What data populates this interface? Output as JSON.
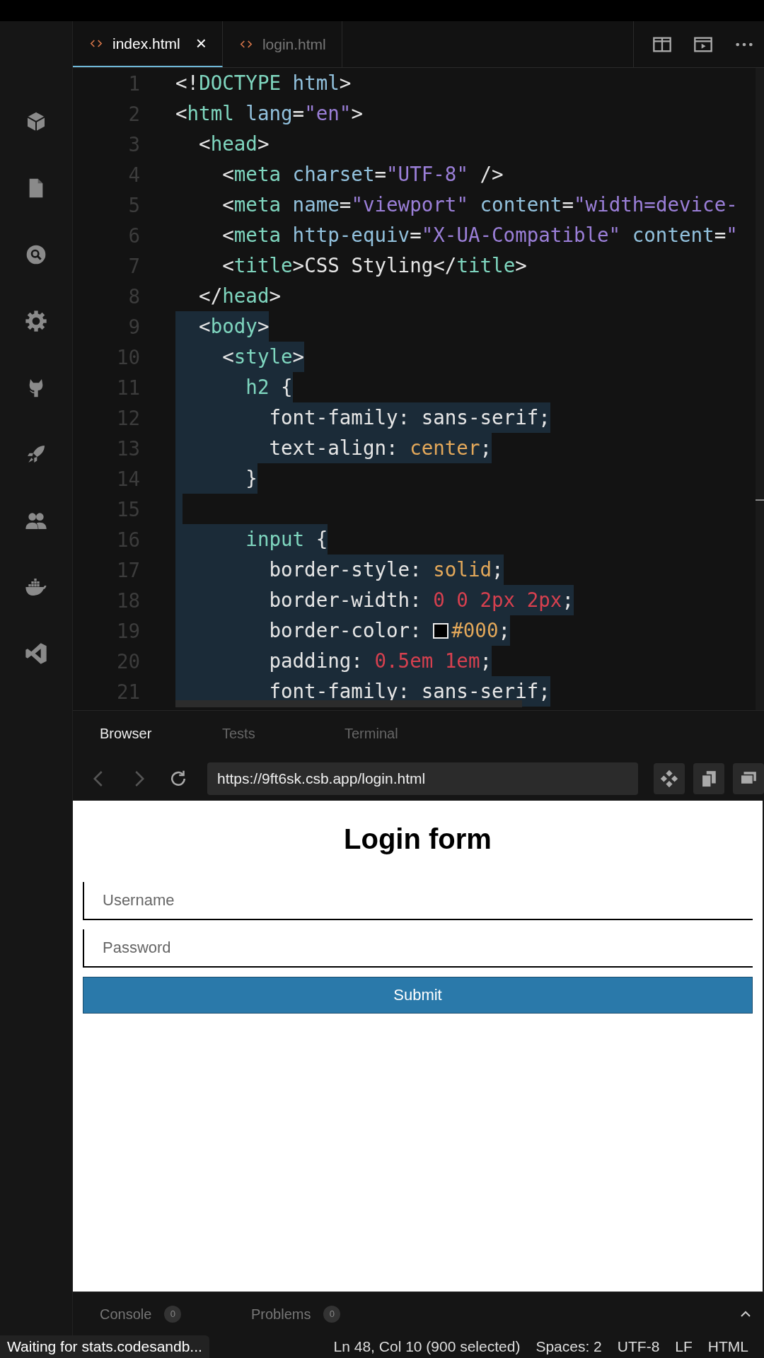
{
  "editor_tabs": [
    {
      "label": "index.html",
      "selected": true,
      "close": "×"
    },
    {
      "label": "login.html",
      "selected": false
    }
  ],
  "code_lines": [
    {
      "number": "1",
      "selected": false,
      "tokens": [
        {
          "text": "<!",
          "kind": "punct"
        },
        {
          "text": "DOCTYPE",
          "kind": "tag"
        },
        {
          "text": " html",
          "kind": "attr"
        },
        {
          "text": ">",
          "kind": "punct"
        }
      ]
    },
    {
      "number": "2",
      "selected": false,
      "tokens": [
        {
          "text": "<",
          "kind": "punct"
        },
        {
          "text": "html",
          "kind": "tag"
        },
        {
          "text": " lang",
          "kind": "attr"
        },
        {
          "text": "=",
          "kind": "punct"
        },
        {
          "text": "\"en\"",
          "kind": "string"
        },
        {
          "text": ">",
          "kind": "punct"
        }
      ]
    },
    {
      "number": "3",
      "selected": false,
      "tokens": [
        {
          "text": "  <",
          "kind": "punct"
        },
        {
          "text": "head",
          "kind": "tag"
        },
        {
          "text": ">",
          "kind": "punct"
        }
      ]
    },
    {
      "number": "4",
      "selected": false,
      "tokens": [
        {
          "text": "    <",
          "kind": "punct"
        },
        {
          "text": "meta",
          "kind": "tag"
        },
        {
          "text": " charset",
          "kind": "attr"
        },
        {
          "text": "=",
          "kind": "punct"
        },
        {
          "text": "\"UTF-8\"",
          "kind": "string"
        },
        {
          "text": " />",
          "kind": "punct"
        }
      ]
    },
    {
      "number": "5",
      "selected": false,
      "tokens": [
        {
          "text": "    <",
          "kind": "punct"
        },
        {
          "text": "meta",
          "kind": "tag"
        },
        {
          "text": " name",
          "kind": "attr"
        },
        {
          "text": "=",
          "kind": "punct"
        },
        {
          "text": "\"viewport\"",
          "kind": "string"
        },
        {
          "text": " content",
          "kind": "attr"
        },
        {
          "text": "=",
          "kind": "punct"
        },
        {
          "text": "\"width=device-",
          "kind": "string"
        }
      ]
    },
    {
      "number": "6",
      "selected": false,
      "tokens": [
        {
          "text": "    <",
          "kind": "punct"
        },
        {
          "text": "meta",
          "kind": "tag"
        },
        {
          "text": " http-equiv",
          "kind": "attr"
        },
        {
          "text": "=",
          "kind": "punct"
        },
        {
          "text": "\"X-UA-Compatible\"",
          "kind": "string"
        },
        {
          "text": " content",
          "kind": "attr"
        },
        {
          "text": "=",
          "kind": "punct"
        },
        {
          "text": "\"",
          "kind": "string"
        }
      ]
    },
    {
      "number": "7",
      "selected": false,
      "tokens": [
        {
          "text": "    <",
          "kind": "punct"
        },
        {
          "text": "title",
          "kind": "tag"
        },
        {
          "text": ">",
          "kind": "punct"
        },
        {
          "text": "CSS Styling",
          "kind": "text"
        },
        {
          "text": "</",
          "kind": "punct"
        },
        {
          "text": "title",
          "kind": "tag"
        },
        {
          "text": ">",
          "kind": "punct"
        }
      ]
    },
    {
      "number": "8",
      "selected": false,
      "tokens": [
        {
          "text": "  </",
          "kind": "punct"
        },
        {
          "text": "head",
          "kind": "tag"
        },
        {
          "text": ">",
          "kind": "punct"
        }
      ]
    },
    {
      "number": "9",
      "selected": true,
      "tokens": [
        {
          "text": "  <",
          "kind": "punct"
        },
        {
          "text": "body",
          "kind": "tag"
        },
        {
          "text": ">",
          "kind": "punct"
        }
      ]
    },
    {
      "number": "10",
      "selected": true,
      "tokens": [
        {
          "text": "    <",
          "kind": "punct"
        },
        {
          "text": "style",
          "kind": "tag"
        },
        {
          "text": ">",
          "kind": "punct"
        }
      ]
    },
    {
      "number": "11",
      "selected": true,
      "tokens": [
        {
          "text": "      h2",
          "kind": "tag"
        },
        {
          "text": " {",
          "kind": "punct"
        }
      ]
    },
    {
      "number": "12",
      "selected": true,
      "tokens": [
        {
          "text": "        font-family: sans-serif;",
          "kind": "text"
        }
      ]
    },
    {
      "number": "13",
      "selected": true,
      "tokens": [
        {
          "text": "        text-align: ",
          "kind": "text"
        },
        {
          "text": "center",
          "kind": "value"
        },
        {
          "text": ";",
          "kind": "text"
        }
      ]
    },
    {
      "number": "14",
      "selected": true,
      "tokens": [
        {
          "text": "      }",
          "kind": "text"
        }
      ]
    },
    {
      "number": "15",
      "selected": true
    },
    {
      "number": "16",
      "selected": true,
      "tokens": [
        {
          "text": "      input",
          "kind": "tag"
        },
        {
          "text": " {",
          "kind": "punct"
        }
      ]
    },
    {
      "number": "17",
      "selected": true,
      "tokens": [
        {
          "text": "        border-style: ",
          "kind": "text"
        },
        {
          "text": "solid",
          "kind": "value"
        },
        {
          "text": ";",
          "kind": "text"
        }
      ]
    },
    {
      "number": "18",
      "selected": true,
      "tokens": [
        {
          "text": "        border-width: ",
          "kind": "text"
        },
        {
          "text": "0 0 2px 2px",
          "kind": "number"
        },
        {
          "text": ";",
          "kind": "text"
        }
      ]
    },
    {
      "number": "19",
      "selected": true,
      "tokens": [
        {
          "text": "        border-color: ",
          "kind": "text"
        },
        {
          "kind": "swatch"
        },
        {
          "text": "#000",
          "kind": "value"
        },
        {
          "text": ";",
          "kind": "text"
        }
      ]
    },
    {
      "number": "20",
      "selected": true,
      "tokens": [
        {
          "text": "        padding: ",
          "kind": "text"
        },
        {
          "text": "0.5em 1em",
          "kind": "number"
        },
        {
          "text": ";",
          "kind": "text"
        }
      ]
    },
    {
      "number": "21",
      "selected": true,
      "tokens": [
        {
          "text": "        font-family: sans-serif;",
          "kind": "text"
        }
      ]
    }
  ],
  "panel_tabs": [
    {
      "label": "Browser",
      "selected": true
    },
    {
      "label": "Tests",
      "selected": false
    },
    {
      "label": "Terminal",
      "selected": false
    }
  ],
  "browser": {
    "url": "https://9ft6sk.csb.app/login.html",
    "page": {
      "heading": "Login form",
      "fields": [
        {
          "placeholder": "Username"
        },
        {
          "placeholder": "Password"
        }
      ],
      "submit": "Submit"
    }
  },
  "bottom_tabs": [
    {
      "label": "Console",
      "count": "0"
    },
    {
      "label": "Problems",
      "count": "0"
    }
  ],
  "status_bar": {
    "message": "Waiting for stats.codesandb...",
    "items": [
      "Ln 48, Col 10 (900 selected)",
      "Spaces: 2",
      "UTF-8",
      "LF",
      "HTML"
    ]
  }
}
